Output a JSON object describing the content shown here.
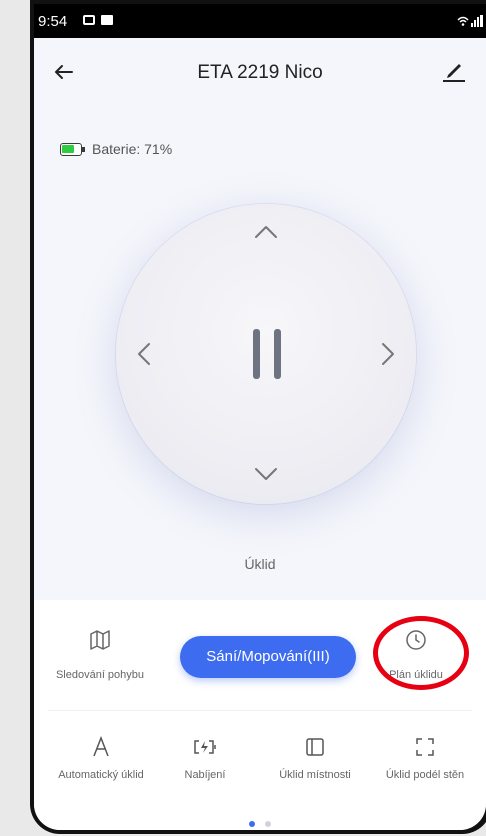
{
  "statusbar": {
    "time": "9:54"
  },
  "header": {
    "title": "ETA 2219 Nico"
  },
  "battery": {
    "label": "Baterie: 71%",
    "level_percent": 71
  },
  "control": {
    "mode_label": "Úklid"
  },
  "actions": {
    "tracking_label": "Sledování pohybu",
    "suction_label": "Sání/Mopování(III)",
    "schedule_label": "Plán úklidu"
  },
  "modes": [
    {
      "label": "Automatický úklid",
      "icon": "letter-a-icon"
    },
    {
      "label": "Nabíjení",
      "icon": "charging-icon"
    },
    {
      "label": "Úklid místnosti",
      "icon": "room-icon"
    },
    {
      "label": "Úklid podél stěn",
      "icon": "edge-corners-icon"
    }
  ],
  "pager": {
    "page_count": 2,
    "active_page": 1
  },
  "colors": {
    "accent": "#3d6cf0",
    "annotation": "#e60012",
    "battery": "#2ecc40"
  }
}
